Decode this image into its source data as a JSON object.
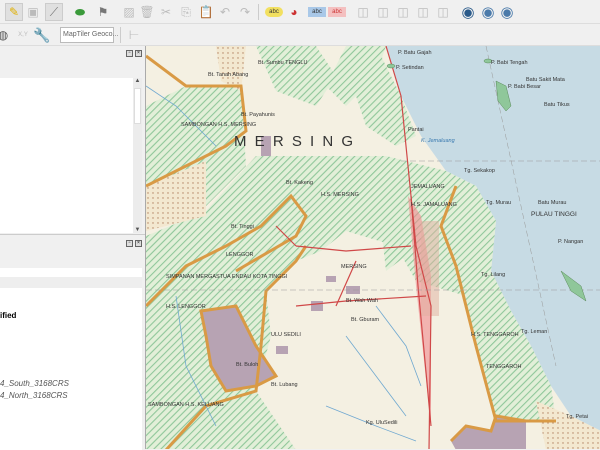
{
  "toolbar1": {
    "icons": [
      "pencil-edit-icon",
      "save-edits-icon",
      "digitize-line-icon",
      "add-feature-icon",
      "vertex-tool-icon",
      "modify-attributes-icon",
      "delete-icon",
      "cut-icon",
      "copy-icon",
      "paste-icon",
      "undo-icon",
      "redo-icon",
      "label-abc-icon",
      "diagram-icon",
      "pin-label-icon",
      "hide-label-icon",
      "label-tool-1-icon",
      "label-tool-2-icon",
      "label-tool-3-icon",
      "label-tool-4-icon",
      "label-tool-5-icon",
      "globe-binoculars-icon",
      "globe-add-icon",
      "globe-download-icon"
    ]
  },
  "toolbar2": {
    "geocoder_placeholder": "MapTiler Geoco..."
  },
  "layers_panel": {
    "items": [
      {
        "text": "ified",
        "style": "bold"
      },
      {
        "text": "4_South_3168CRS",
        "style": "italic"
      },
      {
        "text": "4_North_3168CRS",
        "style": "italic"
      }
    ]
  },
  "map": {
    "colors": {
      "land": "#f4f0e2",
      "sea": "#c7dbe4",
      "forest": "#8fc79a",
      "boundary": "#d99a45",
      "road": "#d04848",
      "highlight": "#f08a90"
    },
    "labels": {
      "mersing_big": "M E R S I N G",
      "tenglu": "Bt. Sumbu TENGLU",
      "tanah_abang": "Bt. Tanah Abang",
      "payahunis": "Bt. Payahunis",
      "jemaluang": "JEMALUANG",
      "hs_jamaluang": "H.S. JAMALUANG",
      "hs_mersing": "H.S. MERSING",
      "mersing_town": "MERSING",
      "lenggor": "LENGGOR",
      "simpanan": "SIMPANAN MERGASTUA ENDAU KOTA TINGGI",
      "hs_lenggor": "H.S. LENGGOR",
      "ulu_sedili": "ULU SEDILI",
      "bt_buloh": "Bt. Buloh",
      "bt_lubang": "Bt. Lubang",
      "kg_ulu_sedili": "Kg. UluSedili",
      "tenggaroh": "TENGGAROH",
      "hs_tenggaroh": "H.S. TENGGAROH",
      "pulau_tinggi": "PULAU TINGGI",
      "batu_murau": "Batu Murau",
      "tg_sekakop": "Tg. Sekakop",
      "tg_murau": "Tg. Murau",
      "p_babi_tengah": "P. Babi Tengah",
      "p_babi_besar": "P. Babi Besar",
      "batu_sakit_mata": "Batu Sakit Mata",
      "batu_tikus": "Batu Tikus",
      "p_setindan": "P. Setindan",
      "p_batu_gajah": "P. Batu Gajah",
      "tg_lilang": "Tg. Lilang",
      "tg_leman": "Tg. Leman",
      "tg_petai": "Tg. Petai",
      "bt_wah_wah": "Bt. Wah Wah",
      "bt_gburam": "Bt. Gburam",
      "bt_tinggi": "Bt. Tinggi",
      "bt_kakeng": "Bt. Kakeng",
      "sambongan_hs_mersing": "SAMBONGAN H.S. MERSING",
      "sambongan_hs_keluang": "SAMBONGAN H.S. KELUANG",
      "k_jemaluang": "K. Jemaluang",
      "pantai": "Pantai",
      "p_nangan": "P. Nangan"
    }
  }
}
